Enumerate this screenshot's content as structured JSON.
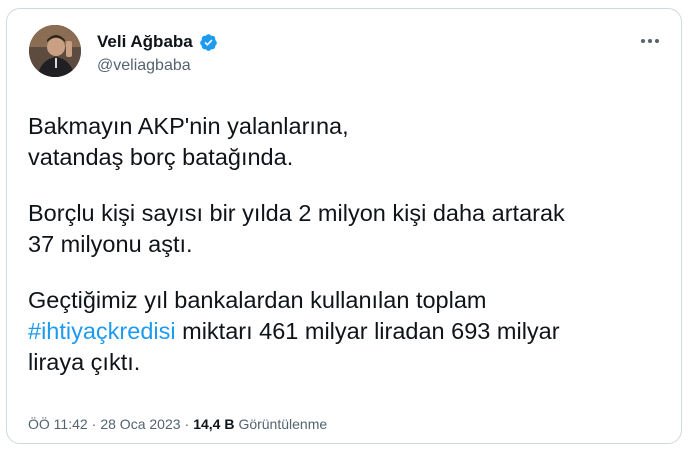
{
  "author": {
    "display_name": "Veli Ağbaba",
    "handle": "@veliagbaba",
    "verified": true,
    "verified_color": "#1d9bf0"
  },
  "tweet": {
    "paragraph1": "Bakmayın AKP'nin yalanlarına,\nvatandaş borç batağında.",
    "paragraph2": "Borçlu kişi sayısı bir yılda 2 milyon kişi daha artarak\n37 milyonu aştı.",
    "paragraph3_before": "Geçtiğimiz yıl bankalardan kullanılan toplam\n",
    "hashtag": "#ihtiyaçkredisi",
    "paragraph3_after": " miktarı 461 milyar liradan 693 milyar\nliraya çıktı."
  },
  "meta": {
    "time": "ÖÖ 11:42",
    "sep1": "·",
    "date": "28 Oca 2023",
    "sep2": "·",
    "views_count": "14,4 B",
    "views_label": "Görüntülenme"
  },
  "icons": {
    "more": "more-options-icon",
    "verified": "verified-badge-icon"
  },
  "colors": {
    "text": "#0f1419",
    "secondary": "#536471",
    "link": "#1d9bf0",
    "border": "#cfd9de"
  }
}
